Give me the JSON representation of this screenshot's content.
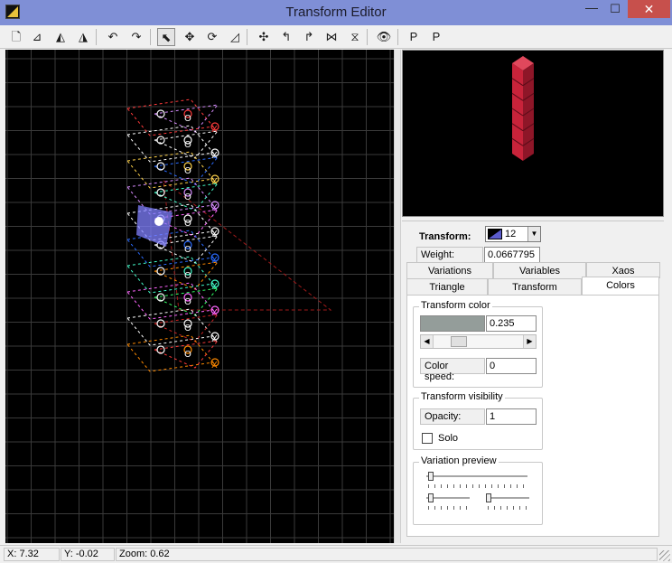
{
  "window": {
    "title": "Transform Editor",
    "icons": {
      "app": "app-logo-icon",
      "min": "minimize-icon",
      "max": "maximize-icon",
      "close": "close-icon"
    },
    "min_glyph": "—",
    "max_glyph": "☐",
    "close_glyph": "✕"
  },
  "toolbar": {
    "buttons": [
      {
        "name": "new-transform-button",
        "icon": "new-document-icon",
        "glyph": "🗋"
      },
      {
        "name": "add-transform-button",
        "icon": "add-triangle-icon",
        "glyph": "⊿"
      },
      {
        "name": "duplicate-transform-button",
        "icon": "duplicate-triangle-icon",
        "glyph": "◭"
      },
      {
        "name": "delete-transform-button",
        "icon": "delete-triangle-icon",
        "glyph": "◮"
      },
      {
        "name": "undo-button",
        "icon": "undo-icon",
        "glyph": "↶"
      },
      {
        "name": "redo-button",
        "icon": "redo-icon",
        "glyph": "↷"
      },
      {
        "name": "select-mode-button",
        "icon": "pointer-icon",
        "glyph": "⬉"
      },
      {
        "name": "move-mode-button",
        "icon": "move-icon",
        "glyph": "✥"
      },
      {
        "name": "rotate-mode-button",
        "icon": "rotate-icon",
        "glyph": "⟳"
      },
      {
        "name": "scale-mode-button",
        "icon": "scale-icon",
        "glyph": "◿"
      },
      {
        "name": "reset-pivot-button",
        "icon": "pivot-icon",
        "glyph": "✣"
      },
      {
        "name": "rotate-left-button",
        "icon": "rotate-left-icon",
        "glyph": "↰"
      },
      {
        "name": "rotate-right-button",
        "icon": "rotate-right-icon",
        "glyph": "↱"
      },
      {
        "name": "flip-horizontal-button",
        "icon": "flip-horizontal-icon",
        "glyph": "⋈"
      },
      {
        "name": "flip-vertical-button",
        "icon": "flip-vertical-icon",
        "glyph": "⧖"
      },
      {
        "name": "toggle-preview-button",
        "icon": "eye-icon",
        "glyph": "👁"
      },
      {
        "name": "post-transform-button",
        "icon": "post-transform-icon",
        "glyph": "P"
      },
      {
        "name": "add-post-transform-button",
        "icon": "add-post-transform-icon",
        "glyph": "P"
      }
    ]
  },
  "panel": {
    "transform_label": "Transform:",
    "transform_value": "12",
    "weight_label": "Weight:",
    "weight_value": "0.0667795",
    "tabs_row1": [
      "Variations",
      "Variables",
      "Xaos"
    ],
    "tabs_row2": [
      "Triangle",
      "Transform",
      "Colors"
    ],
    "selected_tab": "Colors",
    "transform_color": {
      "title": "Transform color",
      "swatch_color": "#949d9a",
      "value": "0.235",
      "slider_fraction": 0.235,
      "color_speed_label": "Color speed:",
      "color_speed_value": "0"
    },
    "visibility": {
      "title": "Transform visibility",
      "opacity_label": "Opacity:",
      "opacity_value": "1",
      "solo_label": "Solo",
      "solo_checked": false
    },
    "variation_preview": {
      "title": "Variation preview"
    }
  },
  "status": {
    "x": "X: 7.32",
    "y": "Y: -0.02",
    "zoom": "Zoom: 0.62"
  },
  "colors": {
    "canvas_bg": "#000000",
    "grid": "#3a3a3a",
    "selected_fill": "#8080ff",
    "preview_cube": "#c8233a"
  }
}
